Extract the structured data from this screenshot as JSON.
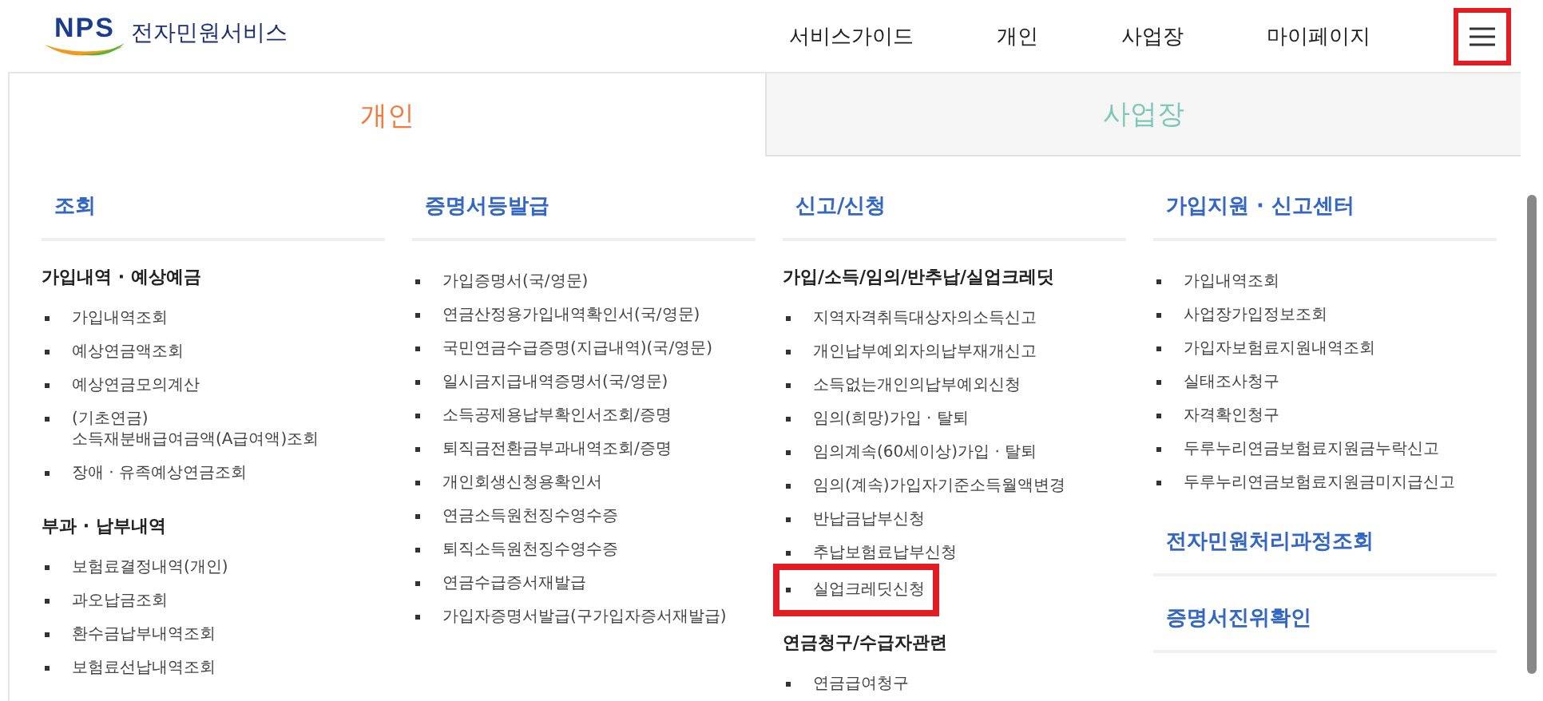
{
  "header": {
    "logo": {
      "mark": "NPS",
      "name": "전자민원서비스"
    },
    "nav": [
      {
        "label": "서비스가이드"
      },
      {
        "label": "개인"
      },
      {
        "label": "사업장"
      },
      {
        "label": "마이페이지"
      }
    ],
    "menu_button": {
      "highlighted": true
    }
  },
  "tabs": [
    {
      "label": "개인",
      "selected": true
    },
    {
      "label": "사업장",
      "selected": false
    }
  ],
  "columns": [
    {
      "sections": [
        {
          "title": "조회",
          "groups": [
            {
              "heading": "가입내역 · 예상예금",
              "items": [
                {
                  "label": "가입내역조회",
                  "highlighted": false
                },
                {
                  "label": "예상연금액조회",
                  "highlighted": false
                },
                {
                  "label": "예상연금모의계산",
                  "highlighted": false
                },
                {
                  "label": "(기초연금)\n소득재분배급여금액(A급여액)조회",
                  "highlighted": false
                },
                {
                  "label": "장애 · 유족예상연금조회",
                  "highlighted": false
                }
              ]
            },
            {
              "heading": "부과 · 납부내역",
              "items": [
                {
                  "label": "보험료결정내역(개인)",
                  "highlighted": false
                },
                {
                  "label": "과오납금조회",
                  "highlighted": false
                },
                {
                  "label": "환수금납부내역조회",
                  "highlighted": false
                },
                {
                  "label": "보험료선납내역조회",
                  "highlighted": false
                }
              ]
            }
          ]
        }
      ]
    },
    {
      "sections": [
        {
          "title": "증명서등발급",
          "groups": [
            {
              "items": [
                {
                  "label": "가입증명서(국/영문)",
                  "highlighted": false
                },
                {
                  "label": "연금산정용가입내역확인서(국/영문)",
                  "highlighted": false
                },
                {
                  "label": "국민연금수급증명(지급내역)(국/영문)",
                  "highlighted": false
                },
                {
                  "label": "일시금지급내역증명서(국/영문)",
                  "highlighted": false
                },
                {
                  "label": "소득공제용납부확인서조회/증명",
                  "highlighted": false
                },
                {
                  "label": "퇴직금전환금부과내역조회/증명",
                  "highlighted": false
                },
                {
                  "label": "개인회생신청용확인서",
                  "highlighted": false
                },
                {
                  "label": "연금소득원천징수영수증",
                  "highlighted": false
                },
                {
                  "label": "퇴직소득원천징수영수증",
                  "highlighted": false
                },
                {
                  "label": "연금수급증서재발급",
                  "highlighted": false
                },
                {
                  "label": "가입자증명서발급(구가입자증서재발급)",
                  "highlighted": false
                }
              ]
            }
          ]
        }
      ]
    },
    {
      "sections": [
        {
          "title": "신고/신청",
          "groups": [
            {
              "heading": "가입/소득/임의/반추납/실업크레딧",
              "items": [
                {
                  "label": "지역자격취득대상자의소득신고",
                  "highlighted": false
                },
                {
                  "label": "개인납부예외자의납부재개신고",
                  "highlighted": false
                },
                {
                  "label": "소득없는개인의납부예외신청",
                  "highlighted": false
                },
                {
                  "label": "임의(희망)가입 · 탈퇴",
                  "highlighted": false
                },
                {
                  "label": "임의계속(60세이상)가입 · 탈퇴",
                  "highlighted": false
                },
                {
                  "label": "임의(계속)가입자기준소득월액변경",
                  "highlighted": false
                },
                {
                  "label": "반납금납부신청",
                  "highlighted": false
                },
                {
                  "label": "추납보험료납부신청",
                  "highlighted": false
                },
                {
                  "label": "실업크레딧신청",
                  "highlighted": true
                }
              ]
            },
            {
              "heading": "연금청구/수급자관련",
              "items": [
                {
                  "label": "연금급여청구",
                  "highlighted": false
                }
              ]
            }
          ]
        }
      ]
    },
    {
      "sections": [
        {
          "title": "가입지원 · 신고센터",
          "groups": [
            {
              "items": [
                {
                  "label": "가입내역조회",
                  "highlighted": false
                },
                {
                  "label": "사업장가입정보조회",
                  "highlighted": false
                },
                {
                  "label": "가입자보험료지원내역조회",
                  "highlighted": false
                },
                {
                  "label": "실태조사청구",
                  "highlighted": false
                },
                {
                  "label": "자격확인청구",
                  "highlighted": false
                },
                {
                  "label": "두루누리연금보험료지원금누락신고",
                  "highlighted": false
                },
                {
                  "label": "두루누리연금보험료지원금미지급신고",
                  "highlighted": false
                }
              ]
            }
          ]
        },
        {
          "title": "전자민원처리과정조회"
        },
        {
          "title": "증명서진위확인"
        }
      ]
    }
  ]
}
